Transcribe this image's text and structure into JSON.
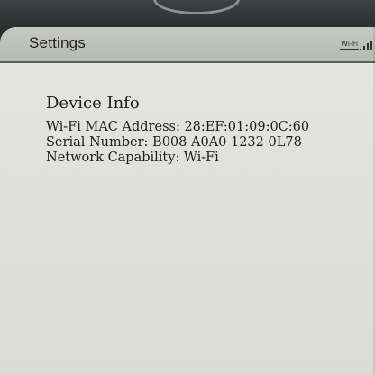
{
  "status_bar": {
    "title": "Settings",
    "wifi_label": "Wi-Fi",
    "signal_icon": "signal-bars-icon"
  },
  "device_info": {
    "title": "Device Info",
    "wifi_mac": "Wi-Fi MAC Address: 28:EF:01:09:0C:60",
    "serial_number": "Serial Number: B008 A0A0 1232 0L78",
    "network_capability": "Network Capability: Wi-Fi"
  },
  "colors": {
    "screen": "#d8d9d4",
    "status_bar": "#bfc1bb",
    "bezel": "#2b2c2e",
    "text": "#1d1d1d"
  }
}
